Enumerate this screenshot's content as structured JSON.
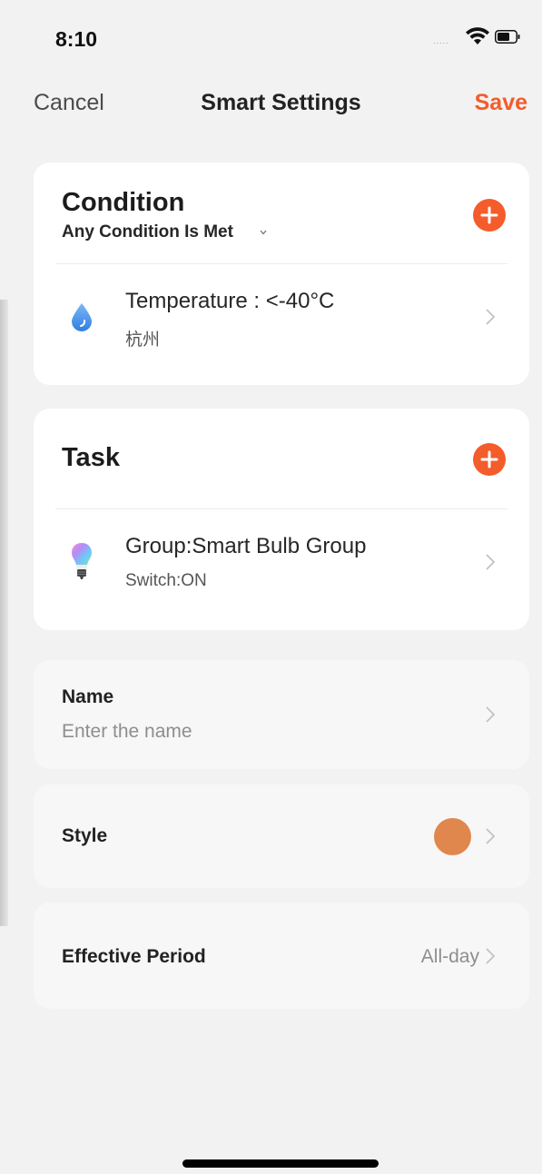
{
  "status_bar": {
    "time": "8:10",
    "signal": "....."
  },
  "nav": {
    "cancel_label": "Cancel",
    "title": "Smart Settings",
    "save_label": "Save"
  },
  "condition": {
    "heading": "Condition",
    "match_mode": "Any Condition Is Met",
    "items": [
      {
        "icon": "water-drop-icon",
        "title": "Temperature : <-40°C",
        "subtitle": "杭州"
      }
    ]
  },
  "task": {
    "heading": "Task",
    "items": [
      {
        "icon": "light-bulb-icon",
        "title": "Group:Smart Bulb Group",
        "subtitle": "Switch:ON"
      }
    ]
  },
  "name_field": {
    "label": "Name",
    "placeholder": "Enter the name"
  },
  "style_field": {
    "label": "Style",
    "color": "#e0874d"
  },
  "period_field": {
    "label": "Effective Period",
    "value": "All-day"
  },
  "colors": {
    "accent": "#f45c2b",
    "background": "#f2f2f2",
    "card": "#ffffff"
  }
}
